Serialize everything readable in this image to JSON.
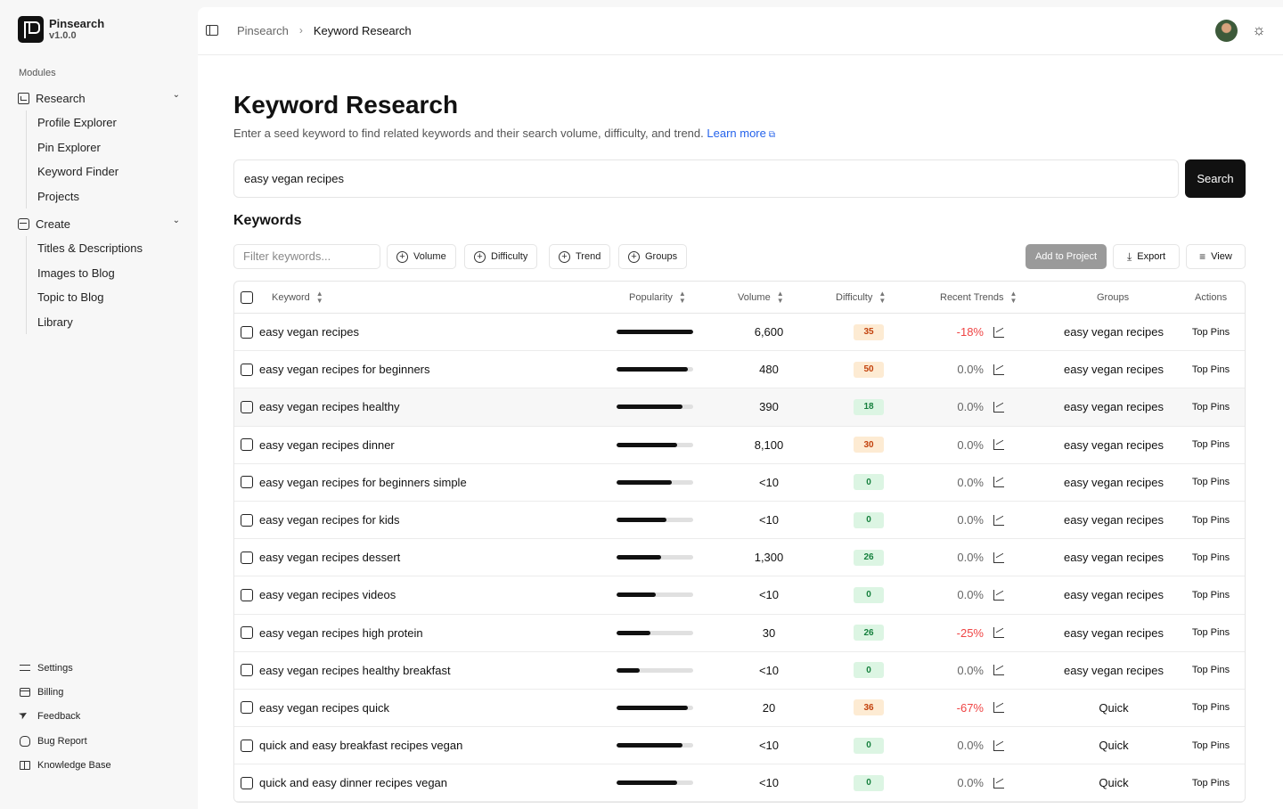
{
  "app": {
    "name": "Pinsearch",
    "version": "v1.0.0"
  },
  "sidebar": {
    "modules_label": "Modules",
    "groups": [
      {
        "label": "Research",
        "items": [
          "Profile Explorer",
          "Pin Explorer",
          "Keyword Finder",
          "Projects"
        ]
      },
      {
        "label": "Create",
        "items": [
          "Titles & Descriptions",
          "Images to Blog",
          "Topic to Blog",
          "Library"
        ]
      }
    ],
    "bottom": [
      "Settings",
      "Billing",
      "Feedback",
      "Bug Report",
      "Knowledge Base"
    ]
  },
  "breadcrumb": {
    "root": "Pinsearch",
    "current": "Keyword Research"
  },
  "page": {
    "title": "Keyword Research",
    "subtitle": "Enter a seed keyword to find related keywords and their search volume, difficulty, and trend.",
    "learn_more": "Learn more"
  },
  "search": {
    "value": "easy vegan recipes",
    "button": "Search"
  },
  "keywords_heading": "Keywords",
  "toolbar": {
    "filter_placeholder": "Filter keywords...",
    "chips": [
      "Volume",
      "Difficulty",
      "Trend",
      "Groups"
    ],
    "add_to_project": "Add to Project",
    "export": "Export",
    "view": "View"
  },
  "table": {
    "headers": {
      "keyword": "Keyword",
      "popularity": "Popularity",
      "volume": "Volume",
      "difficulty": "Difficulty",
      "trends": "Recent Trends",
      "groups": "Groups",
      "actions": "Actions"
    },
    "rows": [
      {
        "keyword": "easy vegan recipes",
        "popularity": 1.0,
        "volume": "6,600",
        "difficulty": "35",
        "trend": "-18%",
        "group": "easy vegan recipes",
        "action": "Top Pins"
      },
      {
        "keyword": "easy vegan recipes for beginners",
        "popularity": 0.93,
        "volume": "480",
        "difficulty": "50",
        "trend": "0.0%",
        "group": "easy vegan recipes",
        "action": "Top Pins"
      },
      {
        "keyword": "easy vegan recipes healthy",
        "popularity": 0.86,
        "volume": "390",
        "difficulty": "18",
        "trend": "0.0%",
        "group": "easy vegan recipes",
        "action": "Top Pins"
      },
      {
        "keyword": "easy vegan recipes dinner",
        "popularity": 0.79,
        "volume": "8,100",
        "difficulty": "30",
        "trend": "0.0%",
        "group": "easy vegan recipes",
        "action": "Top Pins"
      },
      {
        "keyword": "easy vegan recipes for beginners simple",
        "popularity": 0.72,
        "volume": "<10",
        "difficulty": "0",
        "trend": "0.0%",
        "group": "easy vegan recipes",
        "action": "Top Pins"
      },
      {
        "keyword": "easy vegan recipes for kids",
        "popularity": 0.65,
        "volume": "<10",
        "difficulty": "0",
        "trend": "0.0%",
        "group": "easy vegan recipes",
        "action": "Top Pins"
      },
      {
        "keyword": "easy vegan recipes dessert",
        "popularity": 0.58,
        "volume": "1,300",
        "difficulty": "26",
        "trend": "0.0%",
        "group": "easy vegan recipes",
        "action": "Top Pins"
      },
      {
        "keyword": "easy vegan recipes videos",
        "popularity": 0.51,
        "volume": "<10",
        "difficulty": "0",
        "trend": "0.0%",
        "group": "easy vegan recipes",
        "action": "Top Pins"
      },
      {
        "keyword": "easy vegan recipes high protein",
        "popularity": 0.44,
        "volume": "30",
        "difficulty": "26",
        "trend": "-25%",
        "group": "easy vegan recipes",
        "action": "Top Pins"
      },
      {
        "keyword": "easy vegan recipes healthy breakfast",
        "popularity": 0.3,
        "volume": "<10",
        "difficulty": "0",
        "trend": "0.0%",
        "group": "easy vegan recipes",
        "action": "Top Pins"
      },
      {
        "keyword": "easy vegan recipes quick",
        "popularity": 0.93,
        "volume": "20",
        "difficulty": "36",
        "trend": "-67%",
        "group": "Quick",
        "action": "Top Pins"
      },
      {
        "keyword": "quick and easy breakfast recipes vegan",
        "popularity": 0.86,
        "volume": "<10",
        "difficulty": "0",
        "trend": "0.0%",
        "group": "Quick",
        "action": "Top Pins"
      },
      {
        "keyword": "quick and easy dinner recipes vegan",
        "popularity": 0.79,
        "volume": "<10",
        "difficulty": "0",
        "trend": "0.0%",
        "group": "Quick",
        "action": "Top Pins"
      }
    ]
  },
  "colors": {
    "accent_link": "#2563eb",
    "trend_negative": "#ef4444",
    "badge_orange_bg": "#fdebd3",
    "badge_orange_fg": "#c2410c",
    "badge_green_bg": "#dcf5e3",
    "badge_green_fg": "#15803d"
  }
}
